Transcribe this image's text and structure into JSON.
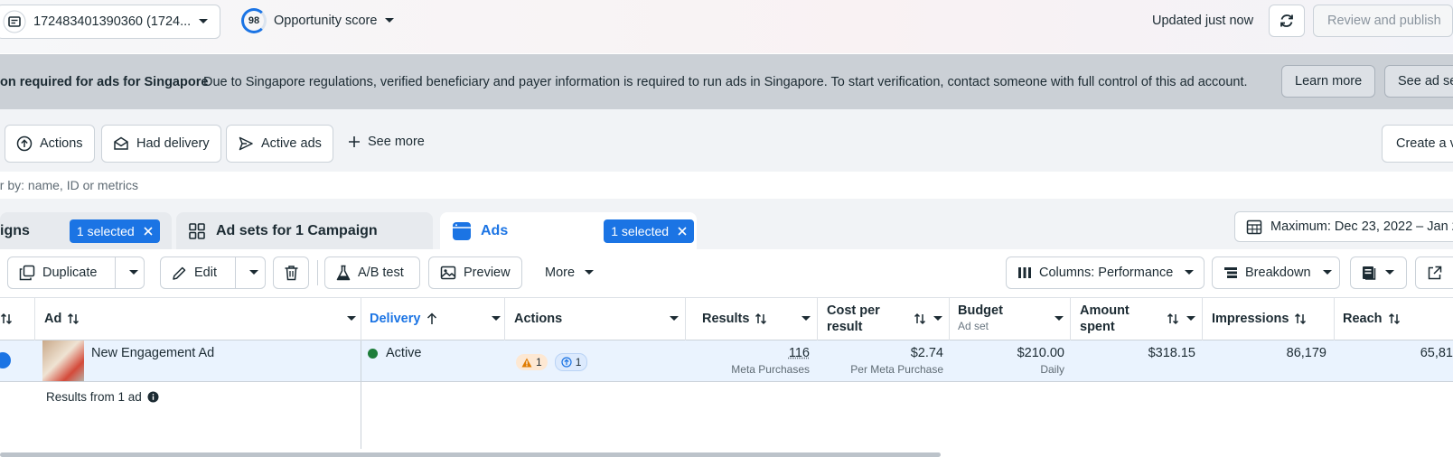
{
  "topbar": {
    "account_label": "172483401390360 (1724...",
    "opportunity_score": "98",
    "opportunity_label": "Opportunity score",
    "updated_text": "Updated just now",
    "publish_label": "Review and publish"
  },
  "banner": {
    "title": "on required for ads for Singapore",
    "message": "Due to Singapore regulations, verified beneficiary and payer information is required to run ads in Singapore. To start verification, contact someone with full control of this ad account.",
    "learn_more": "Learn more",
    "see_ad_sets": "See ad se"
  },
  "filters": {
    "chips": [
      "Actions",
      "Had delivery",
      "Active ads"
    ],
    "see_more": "See more",
    "create_view": "Create a v",
    "search_placeholder": "er by: name, ID or metrics"
  },
  "tabs": {
    "campaigns_title": "igns",
    "campaigns_selected": "1 selected",
    "adsets_title": "Ad sets for 1 Campaign",
    "ads_title": "Ads",
    "ads_selected": "1 selected"
  },
  "date_range": "Maximum: Dec 23, 2022 – Jan 2",
  "toolbar": {
    "duplicate": "Duplicate",
    "edit": "Edit",
    "ab_test": "A/B test",
    "preview": "Preview",
    "more": "More",
    "columns": "Columns: Performance",
    "breakdown": "Breakdown"
  },
  "table": {
    "headers": {
      "ad": "Ad",
      "delivery": "Delivery",
      "actions": "Actions",
      "results": "Results",
      "cost_per_result_1": "Cost per",
      "cost_per_result_2": "result",
      "budget": "Budget",
      "budget_sub": "Ad set",
      "amount_spent_1": "Amount",
      "amount_spent_2": "spent",
      "impressions": "Impressions",
      "reach": "Reach"
    },
    "row": {
      "ad_name": "New Engagement Ad",
      "delivery": "Active",
      "warning_count": "1",
      "action_count": "1",
      "results": "116",
      "results_sub": "Meta Purchases",
      "cost_per_result": "$2.74",
      "cost_sub": "Per Meta Purchase",
      "budget": "$210.00",
      "budget_sub": "Daily",
      "amount_spent": "$318.15",
      "impressions": "86,179",
      "reach": "65,81"
    },
    "summary": "Results from 1 ad"
  },
  "colors": {
    "accent": "#1b74e4",
    "active_dot": "#1e7d3a",
    "warning": "#e07b00"
  }
}
